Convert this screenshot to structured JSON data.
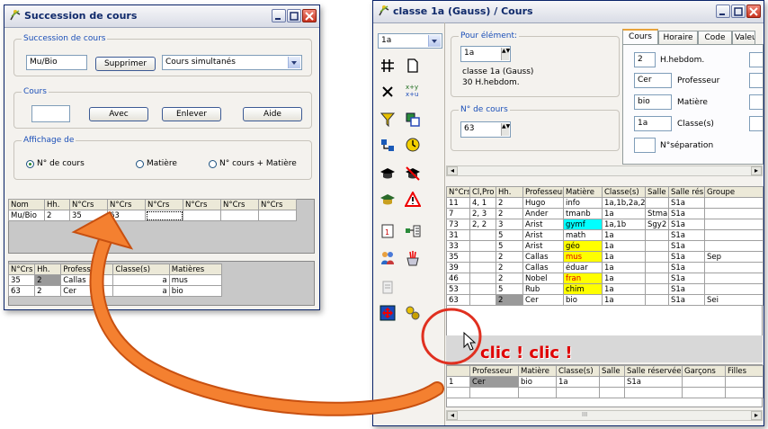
{
  "left_window": {
    "title": "Succession de cours",
    "group_succession": {
      "label": "Succession de cours",
      "value": "Mu/Bio",
      "delete_button": "Supprimer",
      "combo_value": "Cours simultanés"
    },
    "group_cours": {
      "label": "Cours",
      "value": "",
      "add_button": "Avec",
      "remove_button": "Enlever",
      "help_button": "Aide"
    },
    "group_display": {
      "label": "Affichage de",
      "options": [
        "N° de cours",
        "Matière",
        "N° cours + Matière"
      ],
      "selected": "N° de cours"
    },
    "table1": {
      "headers": [
        "Nom",
        "Hh.",
        "N°Crs",
        "N°Crs",
        "N°Crs",
        "N°Crs",
        "N°Crs",
        "N°Crs"
      ],
      "row": [
        "Mu/Bio",
        "2",
        "35",
        "63",
        "",
        "",
        "",
        ""
      ]
    },
    "table2": {
      "headers": [
        "N°Crs",
        "Hh.",
        "Professe",
        "Classe(s)",
        "Matières"
      ],
      "rows": [
        [
          "35",
          "2",
          "Callas",
          "a",
          "mus"
        ],
        [
          "63",
          "2",
          "Cer",
          "a",
          "bio"
        ]
      ]
    }
  },
  "right_window": {
    "title": "classe 1a (Gauss) / Cours",
    "class_combo": "1a",
    "group_element": {
      "label": "Pour élément:",
      "value": "1a",
      "info1": "classe 1a (Gauss)",
      "info2": "30 H.hebdom."
    },
    "group_ncours": {
      "label": "N° de cours",
      "value": "63"
    },
    "tabs": [
      "Cours",
      "Horaire",
      "Code",
      "Valeu"
    ],
    "active_tab": "Cours",
    "tab_fields": [
      {
        "value": "2",
        "label": "H.hebdom."
      },
      {
        "value": "Cer",
        "label": "Professeur"
      },
      {
        "value": "bio",
        "label": "Matière"
      },
      {
        "value": "1a",
        "label": "Classe(s)"
      },
      {
        "value": "",
        "label": "N°séparation"
      }
    ],
    "main_table": {
      "headers": [
        "N°Crs",
        "Cl,Pro",
        "Hh.",
        "Professeur",
        "Matière",
        "Classe(s)",
        "Salle",
        "Salle rés",
        "Groupe"
      ],
      "rows": [
        [
          "11",
          "4, 1",
          "2",
          "Hugo",
          "info",
          "1a,1b,2a,2",
          "",
          "S1a",
          ""
        ],
        [
          "7",
          "2, 3",
          "2",
          "Ander",
          "tmanb",
          "1a",
          "Stma",
          "S1a",
          ""
        ],
        [
          "73",
          "2, 2",
          "3",
          "Arist",
          "gymf",
          "1a,1b",
          "Sgy2",
          "S1a",
          ""
        ],
        [
          "31",
          "",
          "5",
          "Arist",
          "math",
          "1a",
          "",
          "S1a",
          ""
        ],
        [
          "33",
          "",
          "5",
          "Arist",
          "géo",
          "1a",
          "",
          "S1a",
          ""
        ],
        [
          "35",
          "",
          "2",
          "Callas",
          "mus",
          "1a",
          "",
          "S1a",
          "Sep"
        ],
        [
          "39",
          "",
          "2",
          "Callas",
          "éduar",
          "1a",
          "",
          "S1a",
          ""
        ],
        [
          "46",
          "",
          "2",
          "Nobel",
          "fran",
          "1a",
          "",
          "S1a",
          ""
        ],
        [
          "53",
          "",
          "5",
          "Rub",
          "chim",
          "1a",
          "",
          "S1a",
          ""
        ],
        [
          "63",
          "",
          "2",
          "Cer",
          "bio",
          "1a",
          "",
          "S1a",
          "Sei"
        ]
      ]
    },
    "bottom_table": {
      "headers": [
        "",
        "Professeur",
        "Matière",
        "Classe(s)",
        "Salle",
        "Salle réservée",
        "Garçons",
        "Filles"
      ],
      "rows": [
        [
          "1",
          "Cer",
          "bio",
          "1a",
          "",
          "S1a",
          "",
          ""
        ]
      ]
    },
    "scroll_label": "III"
  },
  "annotation": {
    "text": "clic ! clic !",
    "color": "#e00000",
    "arrow_color": "#f07020"
  }
}
